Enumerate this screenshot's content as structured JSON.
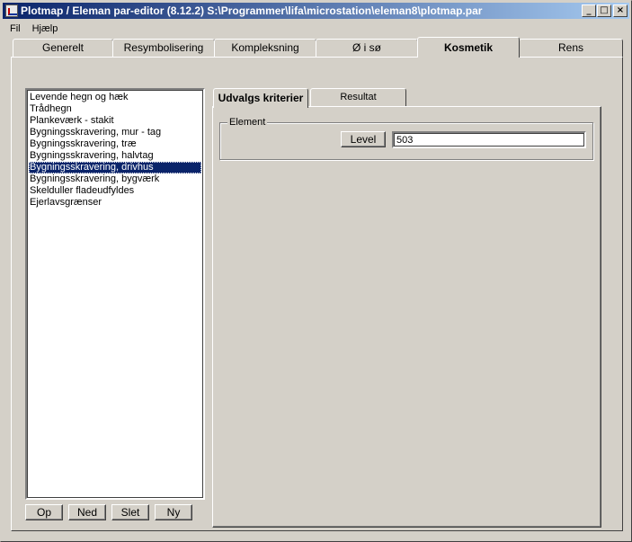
{
  "window": {
    "title": "Plotmap / Eleman par-editor (8.12.2) S:\\Programmer\\lifa\\microstation\\eleman8\\plotmap.par",
    "minimize": "_",
    "maximize": "□",
    "close": "×"
  },
  "menu": [
    "Fil",
    "Hjælp"
  ],
  "main_tabs": [
    "Generelt",
    "Resymbolisering",
    "Kompleksning",
    "Ø i sø",
    "Kosmetik",
    "Rens"
  ],
  "active_main_tab": "Kosmetik",
  "list": {
    "items": [
      "Levende hegn og hæk",
      "Trådhegn",
      "Plankeværk - stakit",
      "Bygningsskravering, mur - tag",
      "Bygningsskravering, træ",
      "Bygningsskravering, halvtag",
      "Bygningsskravering, drivhus",
      "Bygningsskravering, bygværk",
      "Skelduller fladeudfyldes",
      "Ejerlavsgrænser"
    ],
    "selected": "Bygningsskravering, drivhus"
  },
  "list_buttons": [
    "Op",
    "Ned",
    "Slet",
    "Ny"
  ],
  "inner_tabs": [
    "Udvalgs kriterier",
    "Resultat"
  ],
  "active_inner_tab": "Udvalgs kriterier",
  "element_group": {
    "label": "Element",
    "level_button": "Level",
    "level_value": "503"
  }
}
